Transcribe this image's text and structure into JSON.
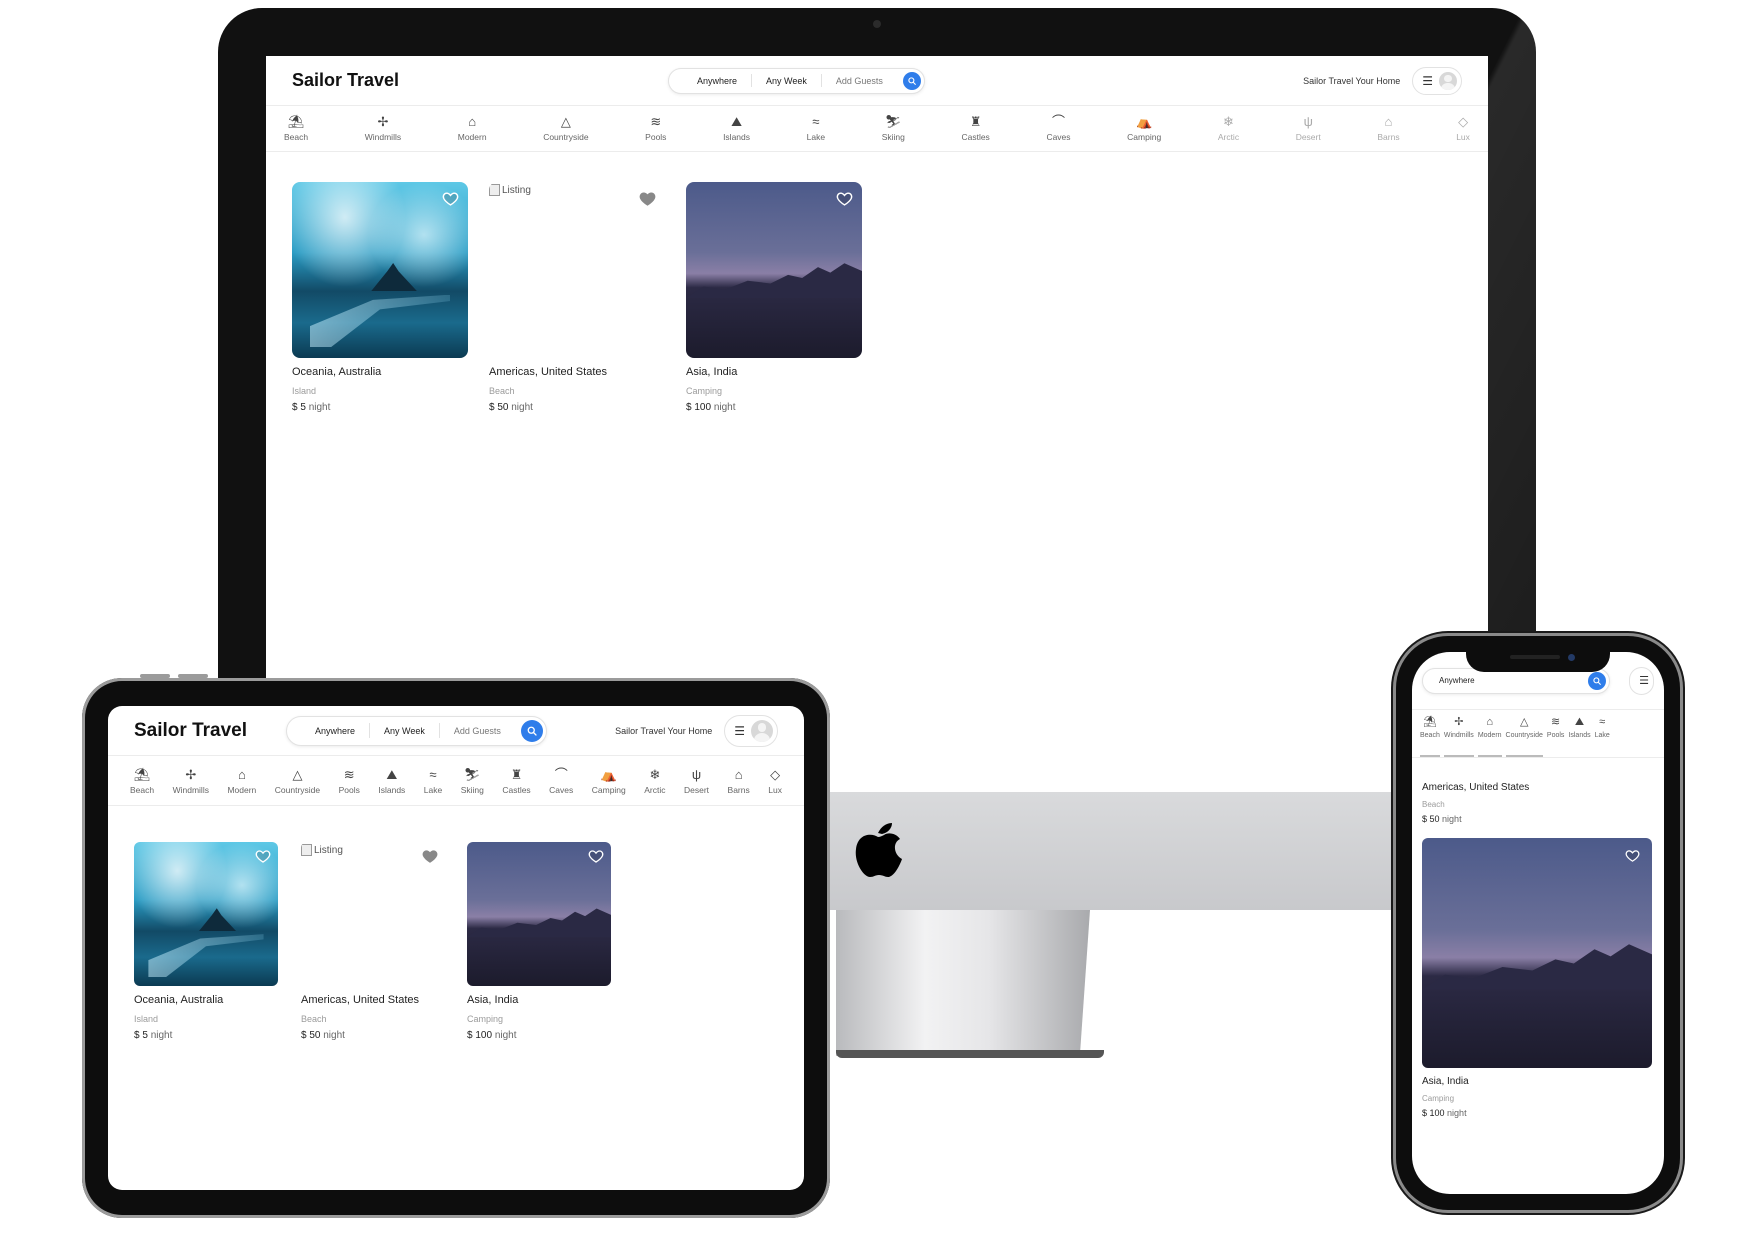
{
  "app": {
    "logo": "Sailor Travel",
    "search": {
      "anywhere": "Anywhere",
      "any_week": "Any Week",
      "add_guests": "Add Guests"
    },
    "host_link": "Sailor Travel Your Home"
  },
  "categories": [
    {
      "label": "Beach",
      "icon": "beach-icon"
    },
    {
      "label": "Windmills",
      "icon": "windmill-icon"
    },
    {
      "label": "Modern",
      "icon": "modern-house-icon"
    },
    {
      "label": "Countryside",
      "icon": "mountain-icon"
    },
    {
      "label": "Pools",
      "icon": "pool-icon"
    },
    {
      "label": "Islands",
      "icon": "island-icon"
    },
    {
      "label": "Lake",
      "icon": "lake-icon"
    },
    {
      "label": "Skiing",
      "icon": "skiing-icon"
    },
    {
      "label": "Castles",
      "icon": "castle-icon"
    },
    {
      "label": "Caves",
      "icon": "cave-icon"
    },
    {
      "label": "Camping",
      "icon": "camping-icon"
    },
    {
      "label": "Arctic",
      "icon": "snowflake-icon"
    },
    {
      "label": "Desert",
      "icon": "cactus-icon"
    },
    {
      "label": "Barns",
      "icon": "barn-icon"
    },
    {
      "label": "Lux",
      "icon": "diamond-icon"
    }
  ],
  "listings": [
    {
      "location": "Oceania, Australia",
      "category": "Island",
      "price": "$ 5",
      "unit": "night",
      "image": "island-photo",
      "alt": ""
    },
    {
      "location": "Americas, United States",
      "category": "Beach",
      "price": "$ 50",
      "unit": "night",
      "image": "broken-image",
      "alt": "Listing"
    },
    {
      "location": "Asia, India",
      "category": "Camping",
      "price": "$ 100",
      "unit": "night",
      "image": "mountain-photo",
      "alt": ""
    }
  ]
}
